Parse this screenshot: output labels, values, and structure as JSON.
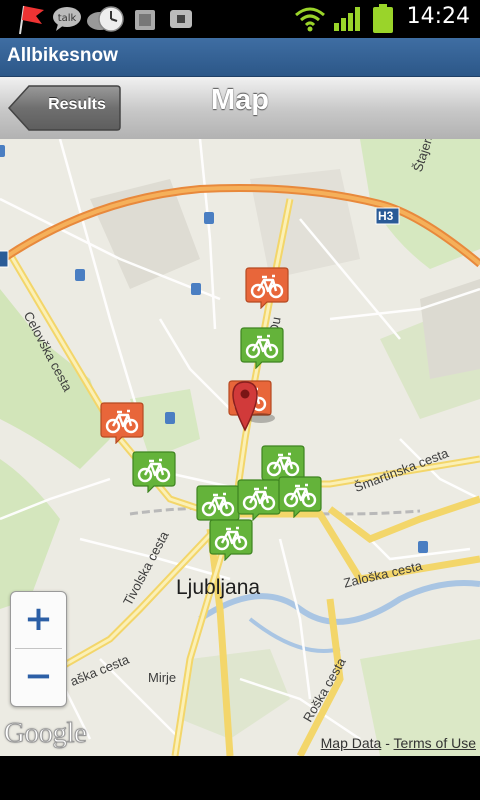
{
  "status_bar": {
    "time": "14:24",
    "icons": [
      "flag-notification-icon",
      "talk-icon",
      "sync-clock-icon",
      "sd-card-icon",
      "lock-icon",
      "wifi-icon",
      "signal-icon",
      "battery-icon"
    ],
    "talk_text": "talk"
  },
  "app": {
    "title": "Allbikesnow"
  },
  "nav": {
    "back_label": "Results",
    "title": "Map"
  },
  "map": {
    "city": "Ljubljana",
    "streets": [
      "Celovška cesta",
      "Tivolska cesta",
      "Šmartinska cesta",
      "Zaloška cesta",
      "Roška cesta",
      "aška cesta",
      "Mirje",
      "Štajerska c",
      "Du"
    ],
    "highway": "H3",
    "markers": [
      {
        "color": "orange",
        "type": "bike-station"
      },
      {
        "color": "green",
        "type": "bike-station"
      },
      {
        "color": "orange",
        "type": "bike-station"
      },
      {
        "color": "orange",
        "type": "bike-station"
      },
      {
        "color": "green",
        "type": "bike-station"
      },
      {
        "color": "green",
        "type": "bike-station"
      },
      {
        "color": "green",
        "type": "bike-station"
      },
      {
        "color": "green",
        "type": "bike-station"
      },
      {
        "color": "green",
        "type": "bike-station"
      },
      {
        "color": "green",
        "type": "bike-station"
      }
    ],
    "zoom_in": "+",
    "zoom_out": "−",
    "logo": "Google",
    "attribution_data": "Map Data",
    "attribution_sep": " - ",
    "attribution_terms": "Terms of Use"
  },
  "colors": {
    "appbar": "#3a679b",
    "marker_orange": "#e8663a",
    "marker_green": "#64b33a",
    "pin": "#d13a3a",
    "highway": "#f0a04a",
    "main_road": "#f7e08a"
  }
}
